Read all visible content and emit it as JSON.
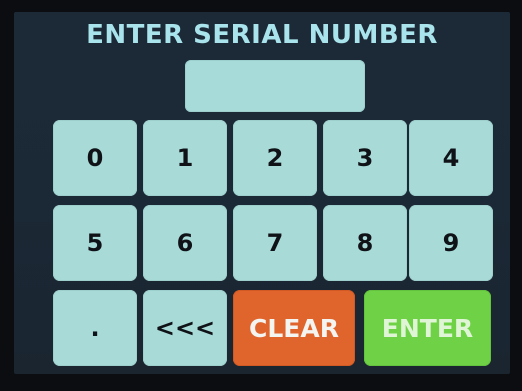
{
  "screen": {
    "title": "ENTER SERIAL NUMBER",
    "serial_value": ""
  },
  "keypad": {
    "row1": [
      "0",
      "1",
      "2",
      "3",
      "4"
    ],
    "row2": [
      "5",
      "6",
      "7",
      "8",
      "9"
    ],
    "dot": ".",
    "backspace": "<<<",
    "clear": "CLEAR",
    "enter": "ENTER"
  },
  "colors": {
    "title": "#a9e4ec",
    "key": "#a8dad8",
    "clear": "#e0652c",
    "enter": "#6fd246",
    "background": "#1c2a38"
  }
}
